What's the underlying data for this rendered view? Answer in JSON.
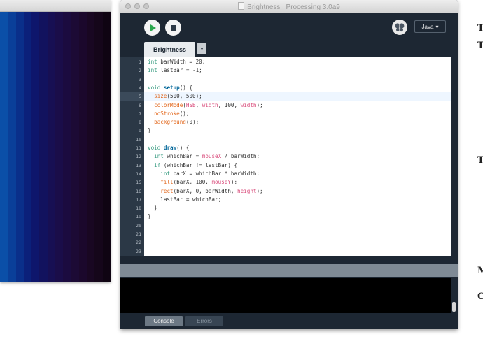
{
  "sketch": {
    "bar_colors": [
      "#0b4fa8",
      "#0a3f99",
      "#0a2f8a",
      "#0b207a",
      "#0e166c",
      "#12125e",
      "#170f53",
      "#1a0d49",
      "#1b0b3f",
      "#1c0a35",
      "#1b082c",
      "#190722",
      "#15061a",
      "#0f0412"
    ]
  },
  "ide": {
    "window_title": "Brightness | Processing 3.0a9",
    "mode_label": "Java",
    "tab_name": "Brightness",
    "tab_menu_glyph": "▾",
    "mode_glyph": "▾",
    "current_line": 5,
    "code_lines": [
      [
        [
          "int",
          "kw"
        ],
        [
          " barWidth = 20;",
          "pl"
        ]
      ],
      [
        [
          "int",
          "kw"
        ],
        [
          " lastBar = -1;",
          "pl"
        ]
      ],
      [],
      [
        [
          "void",
          "kw"
        ],
        [
          " ",
          "pl"
        ],
        [
          "setup",
          "fn"
        ],
        [
          "() {",
          "pl"
        ]
      ],
      [
        [
          "  ",
          "pl"
        ],
        [
          "size",
          "bi"
        ],
        [
          "(500, 500);",
          "pl"
        ]
      ],
      [
        [
          "  ",
          "pl"
        ],
        [
          "colorMode",
          "bi"
        ],
        [
          "(",
          "pl"
        ],
        [
          "HSB",
          "ct"
        ],
        [
          ", ",
          "pl"
        ],
        [
          "width",
          "ct"
        ],
        [
          ", 100, ",
          "pl"
        ],
        [
          "width",
          "ct"
        ],
        [
          ");",
          "pl"
        ]
      ],
      [
        [
          "  ",
          "pl"
        ],
        [
          "noStroke",
          "bi"
        ],
        [
          "();",
          "pl"
        ]
      ],
      [
        [
          "  ",
          "pl"
        ],
        [
          "background",
          "bi"
        ],
        [
          "(0);",
          "pl"
        ]
      ],
      [
        [
          "}",
          "pl"
        ]
      ],
      [],
      [
        [
          "void",
          "kw"
        ],
        [
          " ",
          "pl"
        ],
        [
          "draw",
          "fn"
        ],
        [
          "() {",
          "pl"
        ]
      ],
      [
        [
          "  ",
          "pl"
        ],
        [
          "int",
          "kw"
        ],
        [
          " whichBar = ",
          "pl"
        ],
        [
          "mouseX",
          "ct"
        ],
        [
          " / barWidth;",
          "pl"
        ]
      ],
      [
        [
          "  ",
          "pl"
        ],
        [
          "if",
          "kw"
        ],
        [
          " (whichBar != lastBar) {",
          "pl"
        ]
      ],
      [
        [
          "    ",
          "pl"
        ],
        [
          "int",
          "kw"
        ],
        [
          " barX = whichBar * barWidth;",
          "pl"
        ]
      ],
      [
        [
          "    ",
          "pl"
        ],
        [
          "fill",
          "bi"
        ],
        [
          "(barX, 100, ",
          "pl"
        ],
        [
          "mouseY",
          "ct"
        ],
        [
          ");",
          "pl"
        ]
      ],
      [
        [
          "    ",
          "pl"
        ],
        [
          "rect",
          "bi"
        ],
        [
          "(barX, 0, barWidth, ",
          "pl"
        ],
        [
          "height",
          "ct"
        ],
        [
          ");",
          "pl"
        ]
      ],
      [
        [
          "    lastBar = whichBar;",
          "pl"
        ]
      ],
      [
        [
          "  }",
          "pl"
        ]
      ],
      [
        [
          "}",
          "pl"
        ]
      ],
      [],
      [],
      [],
      []
    ],
    "footer_tabs": {
      "console": "Console",
      "errors": "Errors"
    }
  },
  "edge_text": [
    "T",
    "T",
    "T",
    "M",
    "C"
  ],
  "colors": {
    "ide_background": "#1d2733",
    "run_green": "#2da84e",
    "keyword": "#33997e",
    "function": "#006699",
    "builtin": "#e2661a",
    "constant": "#d94a7a"
  }
}
